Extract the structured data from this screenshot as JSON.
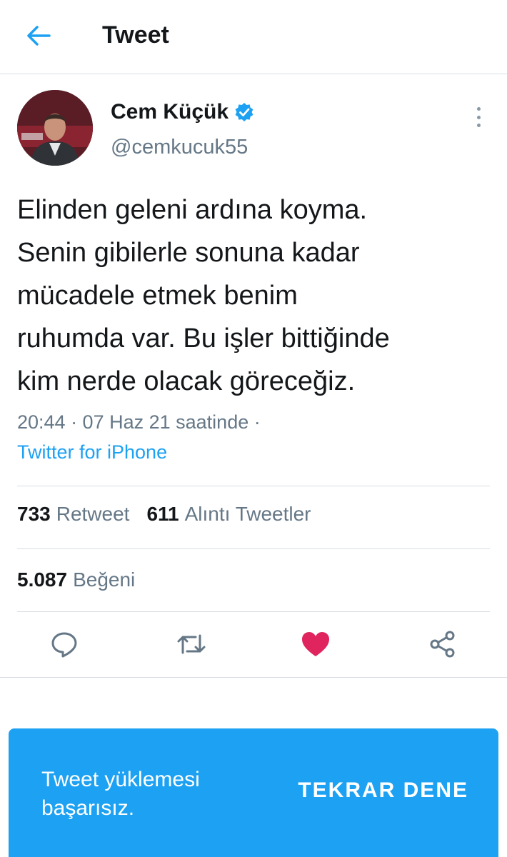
{
  "header": {
    "title": "Tweet"
  },
  "author": {
    "name": "Cem Küçük",
    "handle": "@cemkucuk55",
    "verified": true
  },
  "tweet": {
    "text": "Elinden geleni ardına koyma.\nSenin gibilerle sonuna kadar\nmücadele etmek benim\nruhumda var. Bu işler bittiğinde\nkim nerde olacak göreceğiz.",
    "meta": "20:44 · 07 Haz 21 saatinde ·",
    "source": "Twitter for iPhone"
  },
  "stats": {
    "retweets": {
      "count": "733",
      "label": "Retweet"
    },
    "quotes": {
      "count": "611",
      "label": "Alıntı Tweetler"
    },
    "likes": {
      "count": "5.087",
      "label": "Beğeni"
    }
  },
  "actions": [
    "reply-icon",
    "retweet-icon",
    "like-icon",
    "share-icon"
  ],
  "snackbar": {
    "message": "Tweet yüklemesi başarısız.",
    "button": "TEKRAR DENE"
  },
  "colors": {
    "accent": "#1da1f2",
    "like": "#e0245e",
    "text": "#14171a",
    "secondary": "#657786"
  }
}
